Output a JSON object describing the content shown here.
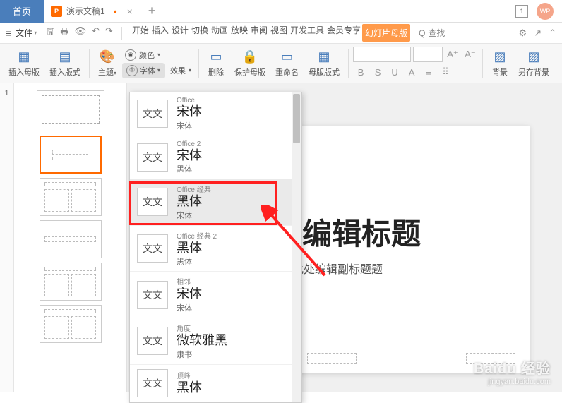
{
  "titlebar": {
    "home": "首页",
    "doc_icon": "P",
    "doc_name": "演示文稿1",
    "dirty": "•",
    "close": "×",
    "new": "+",
    "window_num": "1",
    "avatar": "WP"
  },
  "menubar": {
    "file": "文件",
    "tabs": [
      "开始",
      "插入",
      "设计",
      "切换",
      "动画",
      "放映",
      "审阅",
      "视图",
      "开发工具",
      "会员专享"
    ],
    "active_tab": "幻灯片母版",
    "search_icon": "Q",
    "search": "查找"
  },
  "toolbar": {
    "insert_master": "插入母版",
    "insert_layout": "插入版式",
    "theme": "主题",
    "color": "颜色",
    "font": "字体",
    "effect": "效果",
    "delete": "删除",
    "protect": "保护母版",
    "rename": "重命名",
    "layout": "母版版式",
    "bold": "B",
    "italic": "S",
    "underline": "U",
    "a": "A",
    "bg": "背景",
    "save_bg": "另存背景"
  },
  "outline": {
    "num": "1"
  },
  "slide": {
    "title_partial": "比处编辑标题",
    "subtitle_partial": "占此处编辑副标题题"
  },
  "font_panel": {
    "sample": "文文",
    "items": [
      {
        "name": "Office",
        "main": "宋体",
        "sub": "宋体"
      },
      {
        "name": "Office 2",
        "main": "宋体",
        "sub": "黑体"
      },
      {
        "name": "Office 经典",
        "main": "黑体",
        "sub": "宋体"
      },
      {
        "name": "Office 经典 2",
        "main": "黑体",
        "sub": "黑体"
      },
      {
        "name": "相邻",
        "main": "宋体",
        "sub": "宋体"
      },
      {
        "name": "角度",
        "main": "微软雅黑",
        "sub": "隶书"
      },
      {
        "name": "顶峰",
        "main": "黑体",
        "sub": ""
      }
    ]
  },
  "watermark": {
    "main": "Baidu 经验",
    "sub": "jingyan.baidu.com"
  }
}
